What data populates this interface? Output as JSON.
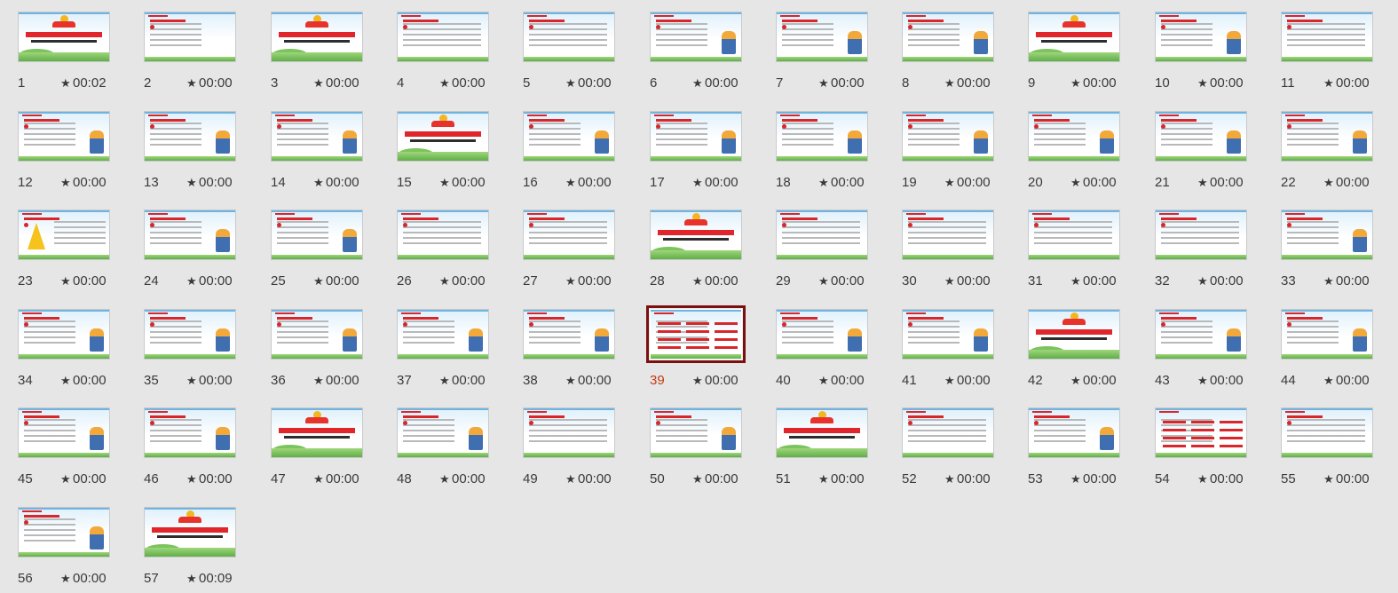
{
  "colors": {
    "background": "#e6e6e6",
    "selected_border": "#7b1010",
    "selected_number": "#c43a10",
    "accent_red": "#d8262b"
  },
  "selected_slide": "39",
  "slides": [
    {
      "number": "1",
      "time": "00:02",
      "type": "cover"
    },
    {
      "number": "2",
      "time": "00:00",
      "type": "toc"
    },
    {
      "number": "3",
      "time": "00:00",
      "type": "section"
    },
    {
      "number": "4",
      "time": "00:00",
      "type": "text"
    },
    {
      "number": "5",
      "time": "00:00",
      "type": "text"
    },
    {
      "number": "6",
      "time": "00:00",
      "type": "text-figure"
    },
    {
      "number": "7",
      "time": "00:00",
      "type": "text-figure"
    },
    {
      "number": "8",
      "time": "00:00",
      "type": "text-figure"
    },
    {
      "number": "9",
      "time": "00:00",
      "type": "section"
    },
    {
      "number": "10",
      "time": "00:00",
      "type": "text-figure"
    },
    {
      "number": "11",
      "time": "00:00",
      "type": "text"
    },
    {
      "number": "12",
      "time": "00:00",
      "type": "text-figure"
    },
    {
      "number": "13",
      "time": "00:00",
      "type": "text-figure"
    },
    {
      "number": "14",
      "time": "00:00",
      "type": "text-figure"
    },
    {
      "number": "15",
      "time": "00:00",
      "type": "section"
    },
    {
      "number": "16",
      "time": "00:00",
      "type": "text-figure"
    },
    {
      "number": "17",
      "time": "00:00",
      "type": "text-figure"
    },
    {
      "number": "18",
      "time": "00:00",
      "type": "text-figure"
    },
    {
      "number": "19",
      "time": "00:00",
      "type": "text-figure"
    },
    {
      "number": "20",
      "time": "00:00",
      "type": "text-figure"
    },
    {
      "number": "21",
      "time": "00:00",
      "type": "text-figure"
    },
    {
      "number": "22",
      "time": "00:00",
      "type": "text-figure"
    },
    {
      "number": "23",
      "time": "00:00",
      "type": "bolt"
    },
    {
      "number": "24",
      "time": "00:00",
      "type": "text-figure"
    },
    {
      "number": "25",
      "time": "00:00",
      "type": "text-figure"
    },
    {
      "number": "26",
      "time": "00:00",
      "type": "text"
    },
    {
      "number": "27",
      "time": "00:00",
      "type": "text"
    },
    {
      "number": "28",
      "time": "00:00",
      "type": "section"
    },
    {
      "number": "29",
      "time": "00:00",
      "type": "text"
    },
    {
      "number": "30",
      "time": "00:00",
      "type": "text"
    },
    {
      "number": "31",
      "time": "00:00",
      "type": "text"
    },
    {
      "number": "32",
      "time": "00:00",
      "type": "text"
    },
    {
      "number": "33",
      "time": "00:00",
      "type": "text-figure"
    },
    {
      "number": "34",
      "time": "00:00",
      "type": "text-figure"
    },
    {
      "number": "35",
      "time": "00:00",
      "type": "text-figure"
    },
    {
      "number": "36",
      "time": "00:00",
      "type": "text-figure"
    },
    {
      "number": "37",
      "time": "00:00",
      "type": "text-figure"
    },
    {
      "number": "38",
      "time": "00:00",
      "type": "text-figure"
    },
    {
      "number": "39",
      "time": "00:00",
      "type": "redgrid"
    },
    {
      "number": "40",
      "time": "00:00",
      "type": "text-figure"
    },
    {
      "number": "41",
      "time": "00:00",
      "type": "text-figure"
    },
    {
      "number": "42",
      "time": "00:00",
      "type": "section"
    },
    {
      "number": "43",
      "time": "00:00",
      "type": "text-figure"
    },
    {
      "number": "44",
      "time": "00:00",
      "type": "text-figure"
    },
    {
      "number": "45",
      "time": "00:00",
      "type": "text-figure"
    },
    {
      "number": "46",
      "time": "00:00",
      "type": "text-figure"
    },
    {
      "number": "47",
      "time": "00:00",
      "type": "section"
    },
    {
      "number": "48",
      "time": "00:00",
      "type": "text-figure"
    },
    {
      "number": "49",
      "time": "00:00",
      "type": "text"
    },
    {
      "number": "50",
      "time": "00:00",
      "type": "text-figure"
    },
    {
      "number": "51",
      "time": "00:00",
      "type": "section"
    },
    {
      "number": "52",
      "time": "00:00",
      "type": "text"
    },
    {
      "number": "53",
      "time": "00:00",
      "type": "text-figure"
    },
    {
      "number": "54",
      "time": "00:00",
      "type": "redgrid"
    },
    {
      "number": "55",
      "time": "00:00",
      "type": "text"
    },
    {
      "number": "56",
      "time": "00:00",
      "type": "text-figure"
    },
    {
      "number": "57",
      "time": "00:09",
      "type": "cover"
    }
  ]
}
